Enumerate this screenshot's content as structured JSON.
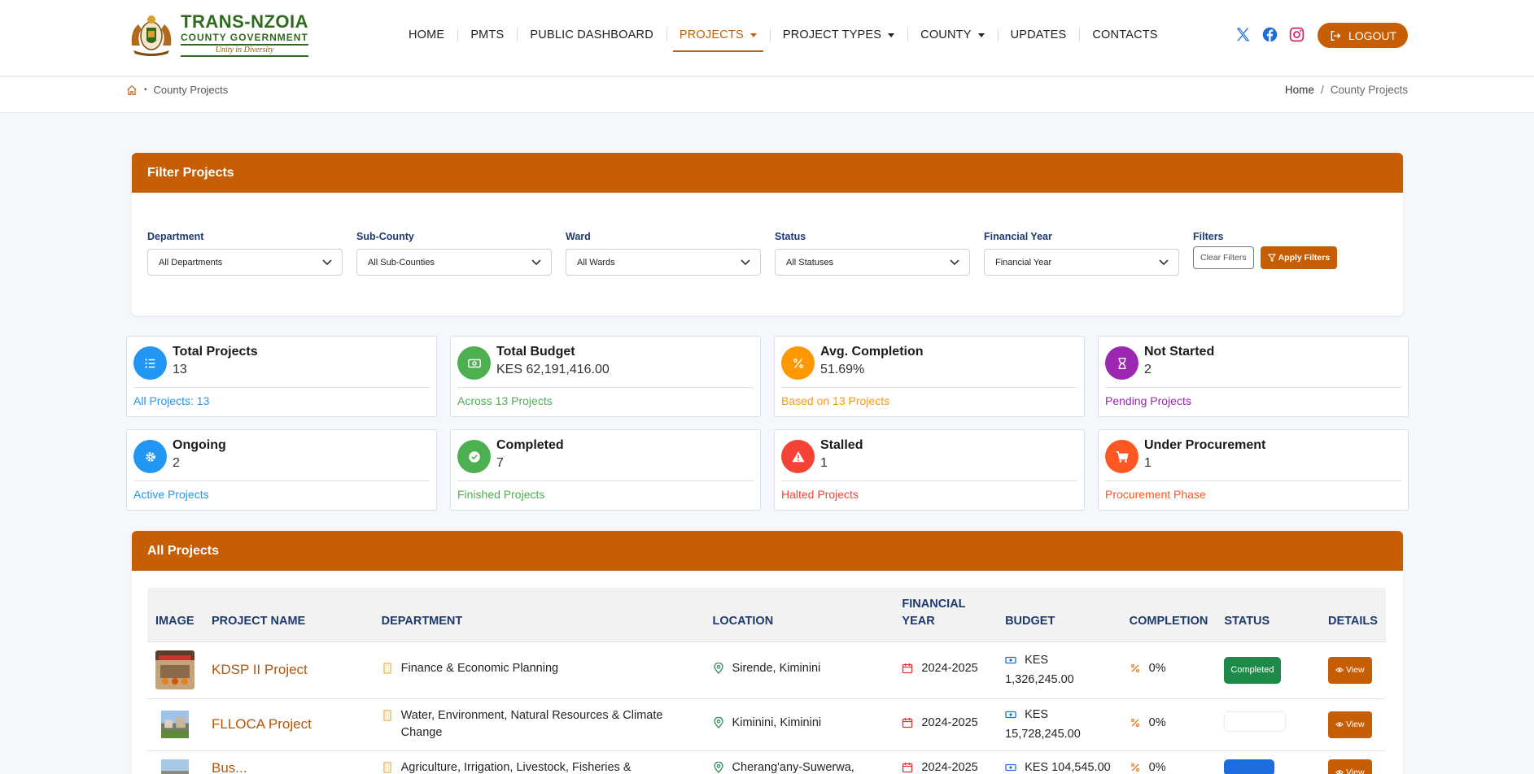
{
  "brand": {
    "title": "TRANS-NZOIA",
    "subtitle": "COUNTY GOVERNMENT",
    "motto": "Unity in Diversity"
  },
  "nav": [
    {
      "label": "HOME"
    },
    {
      "label": "PMTS"
    },
    {
      "label": "PUBLIC DASHBOARD"
    },
    {
      "label": "PROJECTS",
      "active": true,
      "dropdown": true
    },
    {
      "label": "PROJECT TYPES",
      "dropdown": true
    },
    {
      "label": "COUNTY",
      "dropdown": true
    },
    {
      "label": "UPDATES"
    },
    {
      "label": "CONTACTS"
    }
  ],
  "social_icons": [
    "x-icon",
    "facebook-icon",
    "instagram-icon"
  ],
  "logout_label": "LOGOUT",
  "breadcrumb": {
    "left": "County Projects",
    "right_home": "Home",
    "right_separator": "/",
    "right_current": "County Projects"
  },
  "filter": {
    "title": "Filter Projects",
    "fields": [
      {
        "label": "Department",
        "value": "All Departments"
      },
      {
        "label": "Sub-County",
        "value": "All Sub-Counties"
      },
      {
        "label": "Ward",
        "value": "All Wards"
      },
      {
        "label": "Status",
        "value": "All Statuses"
      },
      {
        "label": "Financial Year",
        "value": "Financial Year"
      }
    ],
    "buttons_label": "Filters",
    "clear_label": "Clear Filters",
    "apply_label": "Apply Filters"
  },
  "stats": [
    {
      "title": "Total Projects",
      "value": "13",
      "note": "All Projects: 13",
      "color": "#2196f3",
      "icon": "list-icon"
    },
    {
      "title": "Total Budget",
      "value": "KES 62,191,416.00",
      "note": "Across 13 Projects",
      "color": "#4caf50",
      "icon": "money-icon"
    },
    {
      "title": "Avg. Completion",
      "value": "51.69%",
      "note": "Based on 13 Projects",
      "color": "#ff9800",
      "icon": "percent-icon"
    },
    {
      "title": "Not Started",
      "value": "2",
      "note": "Pending Projects",
      "color": "#9c27b0",
      "icon": "hourglass-icon"
    },
    {
      "title": "Ongoing",
      "value": "2",
      "note": "Active Projects",
      "color": "#2196f3",
      "icon": "gear-icon"
    },
    {
      "title": "Completed",
      "value": "7",
      "note": "Finished Projects",
      "color": "#4caf50",
      "icon": "check-circle-icon"
    },
    {
      "title": "Stalled",
      "value": "1",
      "note": "Halted Projects",
      "color": "#f44336",
      "icon": "warning-icon"
    },
    {
      "title": "Under Procurement",
      "value": "1",
      "note": "Procurement Phase",
      "color": "#ff5722",
      "icon": "cart-icon"
    }
  ],
  "projects": {
    "title": "All Projects",
    "columns": {
      "image": "IMAGE",
      "name": "PROJECT NAME",
      "department": "DEPARTMENT",
      "location": "LOCATION",
      "fy_line1": "FINANCIAL",
      "fy_line2": "YEAR",
      "budget": "BUDGET",
      "completion": "COMPLETION",
      "status": "STATUS",
      "details": "DETAILS"
    },
    "rows": [
      {
        "name": "KDSP II Project",
        "department": "Finance & Economic Planning",
        "location": "Sirende, Kiminini",
        "fy": "2024-2025",
        "budget_line1": "KES",
        "budget_line2": "1,326,245.00",
        "completion": "0%",
        "status": "Completed",
        "view": "View"
      },
      {
        "name": "FLLOCA Project",
        "department": "Water, Environment, Natural Resources & Climate Change",
        "location": "Kiminini, Kiminini",
        "fy": "2024-2025",
        "budget_line1": "KES",
        "budget_line2": "15,728,245.00",
        "completion": "0%",
        "status": "",
        "view": "View"
      },
      {
        "name": "Bus...",
        "department": "Agriculture, Irrigation, Livestock, Fisheries & Cooperative",
        "location": "Cherang'any-Suwerwa,",
        "fy": "2024-2025",
        "budget_line1": "KES 104,545.00",
        "budget_line2": "",
        "completion": "0%",
        "status": "",
        "view": "View"
      }
    ]
  }
}
